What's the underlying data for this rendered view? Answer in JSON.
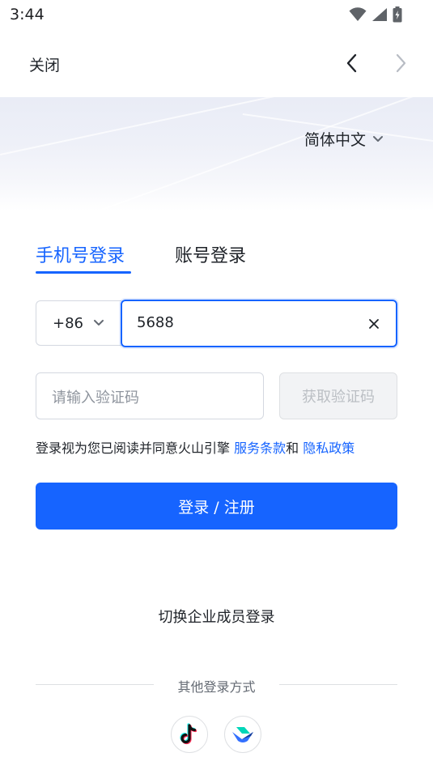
{
  "status_bar": {
    "time": "3:44",
    "icons": [
      "wifi-icon",
      "signal-icon",
      "battery-charging-icon"
    ]
  },
  "nav": {
    "close_label": "关闭",
    "back_icon": "chevron-left-icon",
    "forward_icon": "chevron-right-icon"
  },
  "language": {
    "selected": "简体中文",
    "icon": "chevron-down-icon"
  },
  "tabs": [
    {
      "label": "手机号登录",
      "active": true
    },
    {
      "label": "账号登录",
      "active": false
    }
  ],
  "phone": {
    "country_code": "+86",
    "value": "5688",
    "clear_icon": "clear-icon"
  },
  "verification": {
    "placeholder": "请输入验证码",
    "get_code_label": "获取验证码"
  },
  "agreement": {
    "prefix": "登录视为您已阅读并同意火山引擎 ",
    "terms_link": "服务条款",
    "conjunction": "和 ",
    "privacy_link": "隐私政策"
  },
  "login_button_label": "登录 / 注册",
  "switch_enterprise_label": "切换企业成员登录",
  "other_methods": {
    "label": "其他登录方式",
    "providers": [
      "tiktok-icon",
      "feishu-icon"
    ]
  },
  "colors": {
    "accent": "#1664ff",
    "text": "#1f2329",
    "muted": "#8f959e"
  }
}
